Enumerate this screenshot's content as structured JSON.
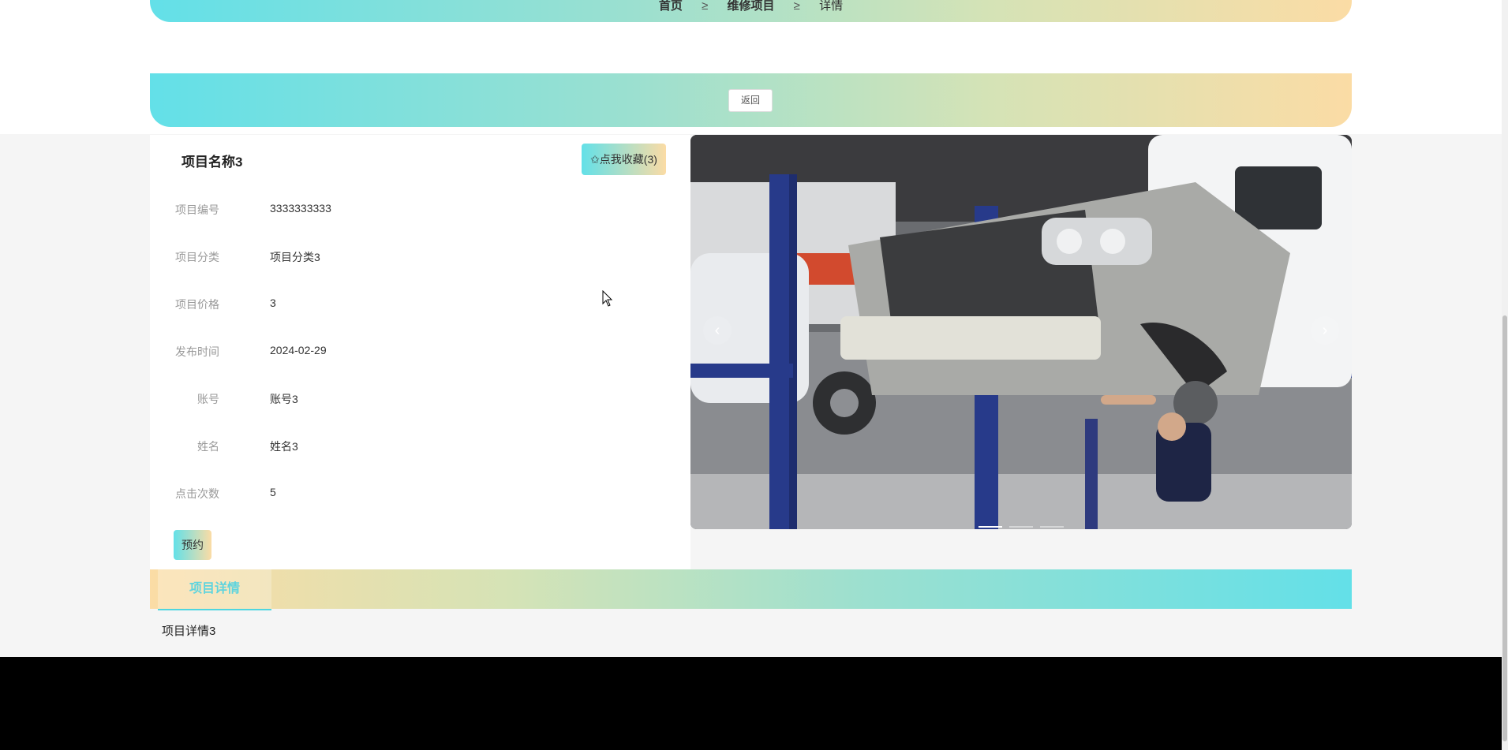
{
  "breadcrumb": {
    "home": "首页",
    "separator": "≥",
    "section": "维修项目",
    "current": "详情"
  },
  "back_button": "返回",
  "project": {
    "title": "项目名称3",
    "favorite_button": "✩点我收藏(3)",
    "fields": [
      {
        "label": "项目编号",
        "value": "3333333333"
      },
      {
        "label": "项目分类",
        "value": "项目分类3"
      },
      {
        "label": "项目价格",
        "value": "3"
      },
      {
        "label": "发布时间",
        "value": "2024-02-29"
      },
      {
        "label": "账号",
        "value": "账号3"
      },
      {
        "label": "姓名",
        "value": "姓名3"
      },
      {
        "label": "点击次数",
        "value": "5"
      }
    ],
    "book_button": "预约"
  },
  "carousel": {
    "prev_glyph": "‹",
    "next_glyph": "›",
    "slide_count": 3,
    "active_index": 0
  },
  "detail": {
    "tab_label": "项目详情",
    "content": "项目详情3"
  },
  "colors": {
    "gradient_start": "#63e0e8",
    "gradient_end": "#fbdca5",
    "tab_accent": "#5fd4de"
  }
}
